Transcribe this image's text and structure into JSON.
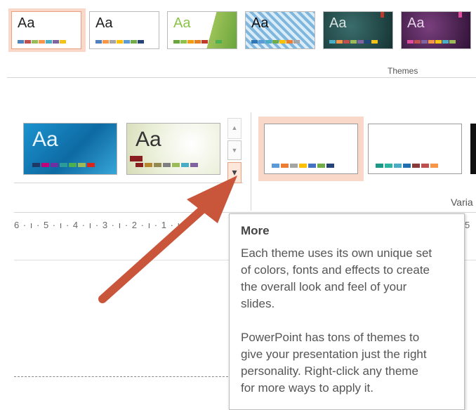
{
  "themes_top": [
    {
      "label": "Aa",
      "bg": "#ffffff",
      "fg": "#222222",
      "bars": [
        "#4f81bd",
        "#c0504d",
        "#9bbb59",
        "#f79646",
        "#4bacc6",
        "#8064a2",
        "#f2c314"
      ]
    },
    {
      "label": "Aa",
      "bg": "#ffffff",
      "fg": "#222222",
      "bars": [
        "#4f81bd",
        "#f79646",
        "#a5a5a5",
        "#ffc000",
        "#5b9bd5",
        "#70ad47",
        "#264478"
      ]
    },
    {
      "label": "Aa",
      "bg": "#ffffff",
      "fg": "#ffffff",
      "bars": [
        "#6aa53d",
        "#8bc34a",
        "#f39c12",
        "#e67e22",
        "#c0392b",
        "#9bbb59",
        "#4caf50"
      ]
    },
    {
      "label": "Aa",
      "bg": "#8ec3e8",
      "fg": "#111111",
      "bars": [
        "#2e75b6",
        "#5b9bd5",
        "#4bacc6",
        "#70ad47",
        "#ffc000",
        "#ed7d31",
        "#a5a5a5"
      ]
    },
    {
      "label": "Aa",
      "bg": "#1f4e4d",
      "fg": "#d8e4e4",
      "bars": [
        "#4bacc6",
        "#f79646",
        "#c0504d",
        "#9bbb59",
        "#8064a2",
        "#1f497d",
        "#f2c314"
      ]
    },
    {
      "label": "Aa",
      "bg": "#4b2457",
      "fg": "#e6d4ea",
      "bars": [
        "#e04c9b",
        "#c0504d",
        "#8064a2",
        "#f79646",
        "#f2c314",
        "#4bacc6",
        "#9bbb59"
      ]
    }
  ],
  "group_label": "Themes",
  "themes_row2": [
    {
      "label": "Aa",
      "bars": [
        "#1f3864",
        "#c0007a",
        "#7030a0",
        "#2e9b9b",
        "#4caf50",
        "#9bbb59",
        "#d9261c"
      ]
    },
    {
      "label": "Aa",
      "bars": [
        "#8a1d1d",
        "#b7872f",
        "#938953",
        "#7f7f7f",
        "#9bbb59",
        "#4bacc6",
        "#8064a2"
      ]
    }
  ],
  "variants": [
    {
      "bars": [
        "#5b9bd5",
        "#ed7d31",
        "#a5a5a5",
        "#ffc000",
        "#4472c4",
        "#70ad47",
        "#264478"
      ]
    },
    {
      "bars": [
        "#1a9988",
        "#2bb5a0",
        "#4bacc6",
        "#1f6fb2",
        "#8b3a3a",
        "#c0504d",
        "#f79646"
      ]
    }
  ],
  "variants_label": "Varia",
  "ruler_text": "6 · ı · 5 · ı · 4 · ı · 3 · ı · 2 · ı · 1 · ı",
  "ruler_right": "5",
  "scroll": {
    "up": "▲",
    "down": "▼",
    "more": "▾"
  },
  "tooltip": {
    "title": "More",
    "paragraph1": [
      "Each theme uses its own unique set",
      "of colors, fonts and effects to create",
      "the overall look and feel of your",
      "slides."
    ],
    "paragraph2": [
      "PowerPoint has tons of themes to",
      "give your presentation just the right",
      "personality. Right-click any theme",
      "for more ways to apply it."
    ]
  },
  "colors": {
    "arrow": "#c9553b",
    "selection": "#f9d8c9",
    "more_border": "#e8a081"
  }
}
